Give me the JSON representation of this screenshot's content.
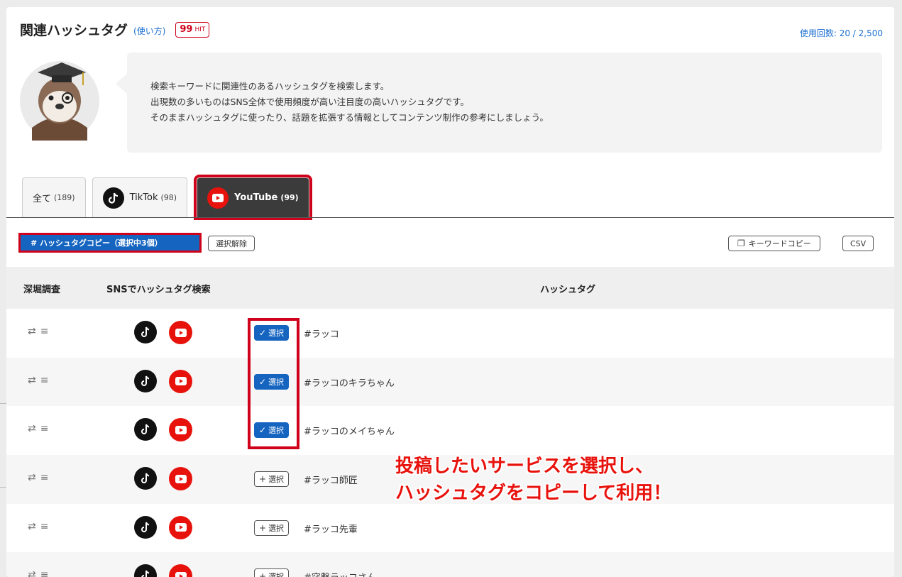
{
  "header": {
    "title": "関連ハッシュタグ",
    "howto_link": "(使い方)",
    "hit_count": "99",
    "hit_unit": "HIT",
    "usage": "使用回数: 20 / 2,500"
  },
  "description": {
    "lines": [
      "検索キーワードに関連性のあるハッシュタグを検索します。",
      "出現数の多いものはSNS全体で使用頻度が高い注目度の高いハッシュタグです。",
      "そのままハッシュタグに使ったり、話題を拡張する情報としてコンテンツ制作の参考にしましょう。"
    ]
  },
  "tabs": [
    {
      "label": "全て",
      "count": "(189)",
      "icon": "none"
    },
    {
      "label": "TikTok",
      "count": "(98)",
      "icon": "tiktok-icon"
    },
    {
      "label": "YouTube",
      "count": "(99)",
      "icon": "youtube-icon",
      "active": true
    }
  ],
  "toolbar": {
    "copy_label": "# ハッシュタグコピー（選択中3個）",
    "unselect_label": "選択解除",
    "keyword_copy_label": "キーワードコピー",
    "csv_label": "CSV"
  },
  "table": {
    "headers": [
      "深堀調査",
      "SNSでハッシュタグ検索",
      "ハッシュタグ"
    ],
    "select_label": "選択",
    "rows": [
      {
        "tag": "#ラッコ",
        "selected": true
      },
      {
        "tag": "#ラッコのキラちゃん",
        "selected": true
      },
      {
        "tag": "#ラッコのメイちゃん",
        "selected": true
      },
      {
        "tag": "#ラッコ師匠",
        "selected": false
      },
      {
        "tag": "#ラッコ先輩",
        "selected": false
      },
      {
        "tag": "#突撃ラッコさん",
        "selected": false
      }
    ]
  },
  "annotation": {
    "line1": "投稿したいサービスを選択し、",
    "line2": "ハッシュタグをコピーして利用！"
  },
  "colors": {
    "accent_blue": "#1565c0",
    "highlight_red": "#d0021b",
    "youtube_red": "#e8120c",
    "tab_active_bg": "#3b3b3b"
  }
}
